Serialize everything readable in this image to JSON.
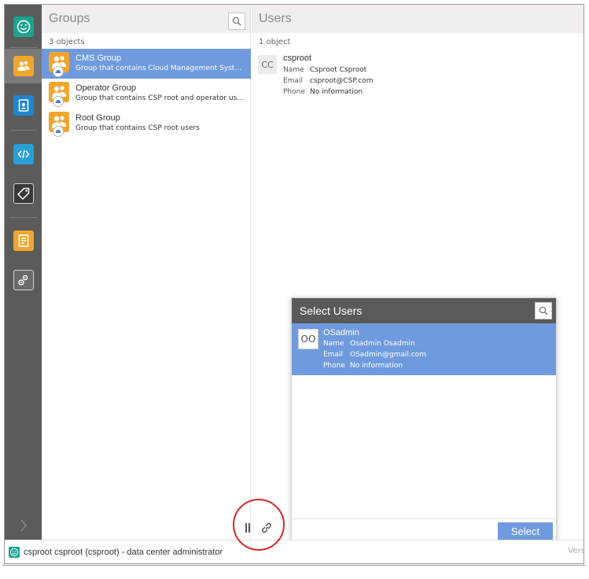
{
  "nav": {
    "items": [
      {
        "icon": "smiley-icon",
        "color": "#1aa38e"
      },
      {
        "icon": "users-icon",
        "color": "#f0a62e"
      },
      {
        "icon": "address-book-icon",
        "color": "#1e86d0"
      },
      {
        "icon": "code-icon",
        "color": "#2a9fd6"
      },
      {
        "icon": "tag-icon",
        "color": "#3a3a3a"
      },
      {
        "icon": "report-icon",
        "color": "#f0a62e"
      },
      {
        "icon": "settings-gear-icon",
        "color": "#6a6a6a"
      }
    ],
    "expand_icon": "chevron-right-icon"
  },
  "groups": {
    "title": "Groups",
    "count": "3 objects",
    "items": [
      {
        "name": "CMS Group",
        "description": "Group that contains Cloud Management System users",
        "selected": true
      },
      {
        "name": "Operator Group",
        "description": "Group that contains CSP root and operator users",
        "selected": false
      },
      {
        "name": "Root Group",
        "description": "Group that contains CSP root users",
        "selected": false
      }
    ]
  },
  "users": {
    "title": "Users",
    "count": "1 object",
    "items": [
      {
        "initials": "CC",
        "username": "csproot",
        "fields": [
          {
            "label": "Name",
            "value": "Csproot Csproot"
          },
          {
            "label": "Email",
            "value": "csproot@CSP.com"
          },
          {
            "label": "Phone",
            "value": "No information"
          }
        ]
      }
    ]
  },
  "select_users_dialog": {
    "title": "Select Users",
    "items": [
      {
        "initials": "OO",
        "username": "OSadmin",
        "fields": [
          {
            "label": "Name",
            "value": "Osadmin Osadmin"
          },
          {
            "label": "Email",
            "value": "OSadmin@gmail.com"
          },
          {
            "label": "Phone",
            "value": "No information"
          }
        ]
      }
    ],
    "select_label": "Select"
  },
  "status_bar": {
    "text": "csproot csproot (csproot) - data center administrator",
    "version": "Vers"
  },
  "colors": {
    "selection": "#6f9bde",
    "nav_bg": "#5b5b5b",
    "highlight_circle": "#d42b2b"
  }
}
